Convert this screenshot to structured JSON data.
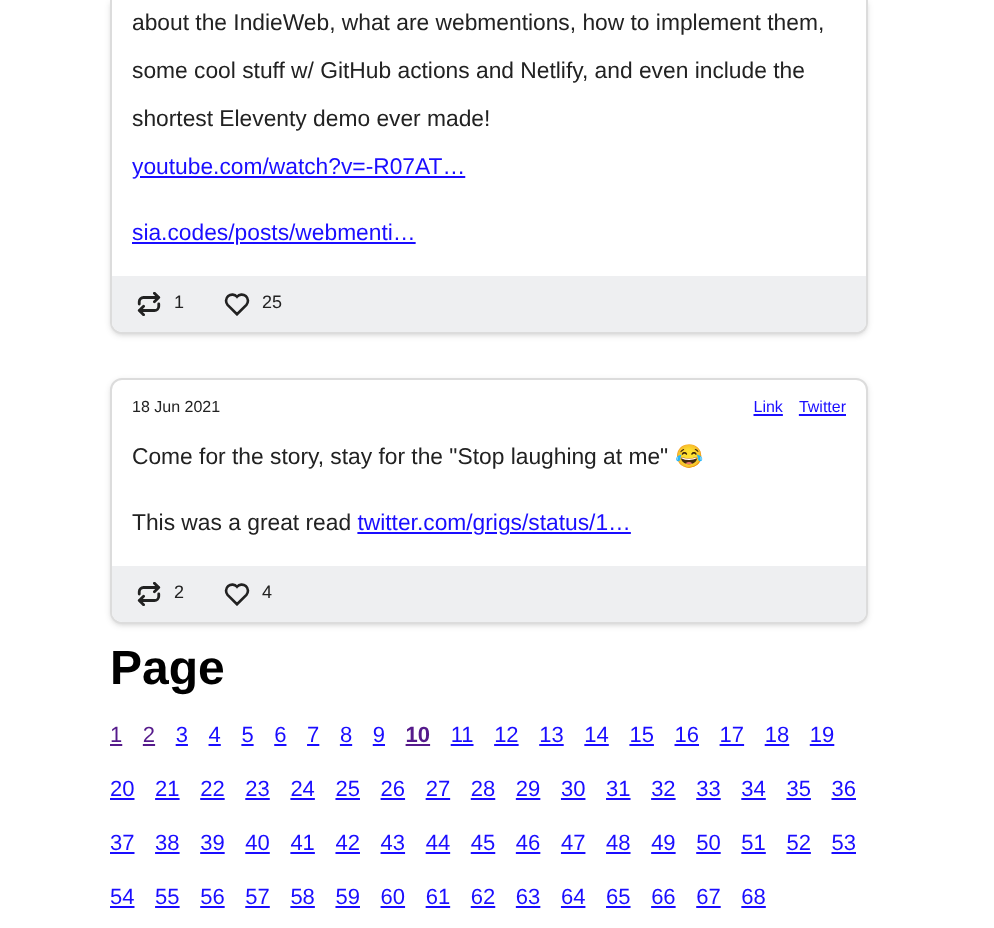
{
  "posts": [
    {
      "paragraphs": [
        {
          "text": "about the IndieWeb, what are webmentions, how to implement them, some cool stuff w/ GitHub actions and Netlify, and even include the shortest Eleventy demo ever made!",
          "link": "youtube.com/watch?v=-R07AT…"
        },
        {
          "link": "sia.codes/posts/webmenti…"
        }
      ],
      "reposts": "1",
      "likes": "25"
    },
    {
      "date": "18 Jun 2021",
      "links": [
        "Link",
        "Twitter"
      ],
      "paragraphs": [
        {
          "text": "Come for the story, stay for the \"Stop laughing at me\" 😂"
        },
        {
          "text": "This was a great read",
          "link": "twitter.com/grigs/status/1…"
        }
      ],
      "reposts": "2",
      "likes": "4"
    }
  ],
  "pagination": {
    "heading": "Page",
    "pages": [
      {
        "label": "1",
        "visited": true,
        "current": false
      },
      {
        "label": "2",
        "visited": true,
        "current": false
      },
      {
        "label": "3",
        "visited": false,
        "current": false
      },
      {
        "label": "4",
        "visited": false,
        "current": false
      },
      {
        "label": "5",
        "visited": false,
        "current": false
      },
      {
        "label": "6",
        "visited": false,
        "current": false
      },
      {
        "label": "7",
        "visited": false,
        "current": false
      },
      {
        "label": "8",
        "visited": false,
        "current": false
      },
      {
        "label": "9",
        "visited": false,
        "current": false
      },
      {
        "label": "10",
        "visited": true,
        "current": true
      },
      {
        "label": "11",
        "visited": false,
        "current": false
      },
      {
        "label": "12",
        "visited": false,
        "current": false
      },
      {
        "label": "13",
        "visited": false,
        "current": false
      },
      {
        "label": "14",
        "visited": false,
        "current": false
      },
      {
        "label": "15",
        "visited": false,
        "current": false
      },
      {
        "label": "16",
        "visited": false,
        "current": false
      },
      {
        "label": "17",
        "visited": false,
        "current": false
      },
      {
        "label": "18",
        "visited": false,
        "current": false
      },
      {
        "label": "19",
        "visited": false,
        "current": false
      },
      {
        "label": "20",
        "visited": false,
        "current": false
      },
      {
        "label": "21",
        "visited": false,
        "current": false
      },
      {
        "label": "22",
        "visited": false,
        "current": false
      },
      {
        "label": "23",
        "visited": false,
        "current": false
      },
      {
        "label": "24",
        "visited": false,
        "current": false
      },
      {
        "label": "25",
        "visited": false,
        "current": false
      },
      {
        "label": "26",
        "visited": false,
        "current": false
      },
      {
        "label": "27",
        "visited": false,
        "current": false
      },
      {
        "label": "28",
        "visited": false,
        "current": false
      },
      {
        "label": "29",
        "visited": false,
        "current": false
      },
      {
        "label": "30",
        "visited": false,
        "current": false
      },
      {
        "label": "31",
        "visited": false,
        "current": false
      },
      {
        "label": "32",
        "visited": false,
        "current": false
      },
      {
        "label": "33",
        "visited": false,
        "current": false
      },
      {
        "label": "34",
        "visited": false,
        "current": false
      },
      {
        "label": "35",
        "visited": false,
        "current": false
      },
      {
        "label": "36",
        "visited": false,
        "current": false
      },
      {
        "label": "37",
        "visited": false,
        "current": false
      },
      {
        "label": "38",
        "visited": false,
        "current": false
      },
      {
        "label": "39",
        "visited": false,
        "current": false
      },
      {
        "label": "40",
        "visited": false,
        "current": false
      },
      {
        "label": "41",
        "visited": false,
        "current": false
      },
      {
        "label": "42",
        "visited": false,
        "current": false
      },
      {
        "label": "43",
        "visited": false,
        "current": false
      },
      {
        "label": "44",
        "visited": false,
        "current": false
      },
      {
        "label": "45",
        "visited": false,
        "current": false
      },
      {
        "label": "46",
        "visited": false,
        "current": false
      },
      {
        "label": "47",
        "visited": false,
        "current": false
      },
      {
        "label": "48",
        "visited": false,
        "current": false
      },
      {
        "label": "49",
        "visited": false,
        "current": false
      },
      {
        "label": "50",
        "visited": false,
        "current": false
      },
      {
        "label": "51",
        "visited": false,
        "current": false
      },
      {
        "label": "52",
        "visited": false,
        "current": false
      },
      {
        "label": "53",
        "visited": false,
        "current": false
      },
      {
        "label": "54",
        "visited": false,
        "current": false
      },
      {
        "label": "55",
        "visited": false,
        "current": false
      },
      {
        "label": "56",
        "visited": false,
        "current": false
      },
      {
        "label": "57",
        "visited": false,
        "current": false
      },
      {
        "label": "58",
        "visited": false,
        "current": false
      },
      {
        "label": "59",
        "visited": false,
        "current": false
      },
      {
        "label": "60",
        "visited": false,
        "current": false
      },
      {
        "label": "61",
        "visited": false,
        "current": false
      },
      {
        "label": "62",
        "visited": false,
        "current": false
      },
      {
        "label": "63",
        "visited": false,
        "current": false
      },
      {
        "label": "64",
        "visited": false,
        "current": false
      },
      {
        "label": "65",
        "visited": false,
        "current": false
      },
      {
        "label": "66",
        "visited": false,
        "current": false
      },
      {
        "label": "67",
        "visited": false,
        "current": false
      },
      {
        "label": "68",
        "visited": false,
        "current": false
      }
    ]
  }
}
